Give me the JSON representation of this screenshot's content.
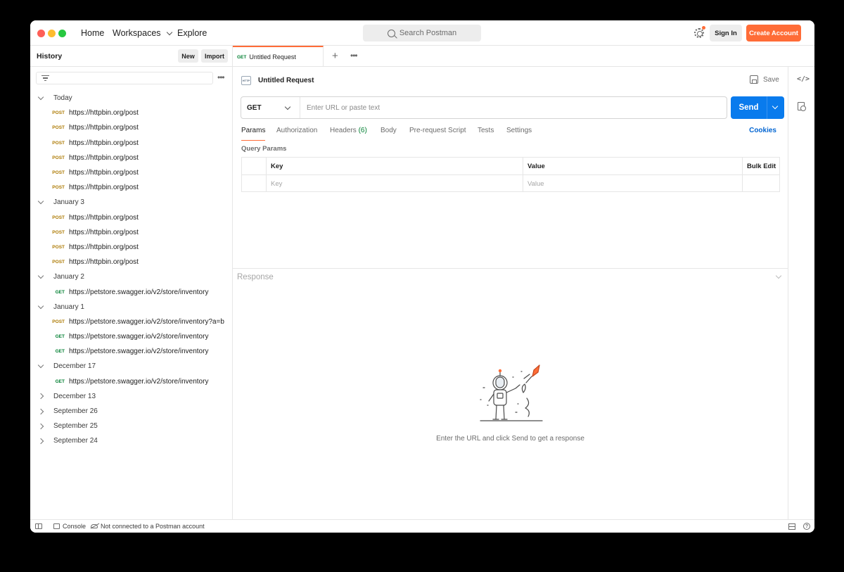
{
  "titlebar": {
    "nav": {
      "home": "Home",
      "workspaces": "Workspaces",
      "explore": "Explore"
    },
    "search_placeholder": "Search Postman",
    "sign_in": "Sign In",
    "create_account": "Create Account",
    "accent_color": "#ff6c37"
  },
  "sidebar": {
    "title": "History",
    "new_label": "New",
    "import_label": "Import",
    "groups": [
      {
        "label": "Today",
        "expanded": true,
        "items": [
          {
            "method": "POST",
            "url": "https://httpbin.org/post"
          },
          {
            "method": "POST",
            "url": "https://httpbin.org/post"
          },
          {
            "method": "POST",
            "url": "https://httpbin.org/post"
          },
          {
            "method": "POST",
            "url": "https://httpbin.org/post"
          },
          {
            "method": "POST",
            "url": "https://httpbin.org/post"
          },
          {
            "method": "POST",
            "url": "https://httpbin.org/post"
          }
        ]
      },
      {
        "label": "January 3",
        "expanded": true,
        "items": [
          {
            "method": "POST",
            "url": "https://httpbin.org/post"
          },
          {
            "method": "POST",
            "url": "https://httpbin.org/post"
          },
          {
            "method": "POST",
            "url": "https://httpbin.org/post"
          },
          {
            "method": "POST",
            "url": "https://httpbin.org/post"
          }
        ]
      },
      {
        "label": "January 2",
        "expanded": true,
        "items": [
          {
            "method": "GET",
            "url": "https://petstore.swagger.io/v2/store/inventory"
          }
        ]
      },
      {
        "label": "January 1",
        "expanded": true,
        "items": [
          {
            "method": "POST",
            "url": "https://petstore.swagger.io/v2/store/inventory?a=b"
          },
          {
            "method": "GET",
            "url": "https://petstore.swagger.io/v2/store/inventory"
          },
          {
            "method": "GET",
            "url": "https://petstore.swagger.io/v2/store/inventory"
          }
        ]
      },
      {
        "label": "December 17",
        "expanded": true,
        "items": [
          {
            "method": "GET",
            "url": "https://petstore.swagger.io/v2/store/inventory"
          }
        ]
      },
      {
        "label": "December 13",
        "expanded": false,
        "items": []
      },
      {
        "label": "September 26",
        "expanded": false,
        "items": []
      },
      {
        "label": "September 25",
        "expanded": false,
        "items": []
      },
      {
        "label": "September 24",
        "expanded": false,
        "items": []
      }
    ]
  },
  "tabs": [
    {
      "method": "GET",
      "label": "Untitled Request"
    }
  ],
  "request": {
    "name": "Untitled Request",
    "save_label": "Save",
    "method": "GET",
    "url_placeholder": "Enter URL or paste text",
    "send_label": "Send",
    "send_color": "#097bed",
    "subtabs": {
      "params": "Params",
      "authorization": "Authorization",
      "headers": "Headers",
      "headers_count": "(6)",
      "body": "Body",
      "prerequest": "Pre-request Script",
      "tests": "Tests",
      "settings": "Settings"
    },
    "cookies_label": "Cookies",
    "query_params_title": "Query Params",
    "table": {
      "key_header": "Key",
      "value_header": "Value",
      "bulk_edit": "Bulk Edit",
      "key_placeholder": "Key",
      "value_placeholder": "Value"
    }
  },
  "response": {
    "title": "Response",
    "empty_message": "Enter the URL and click Send to get a response"
  },
  "statusbar": {
    "console": "Console",
    "connection": "Not connected to a Postman account"
  }
}
